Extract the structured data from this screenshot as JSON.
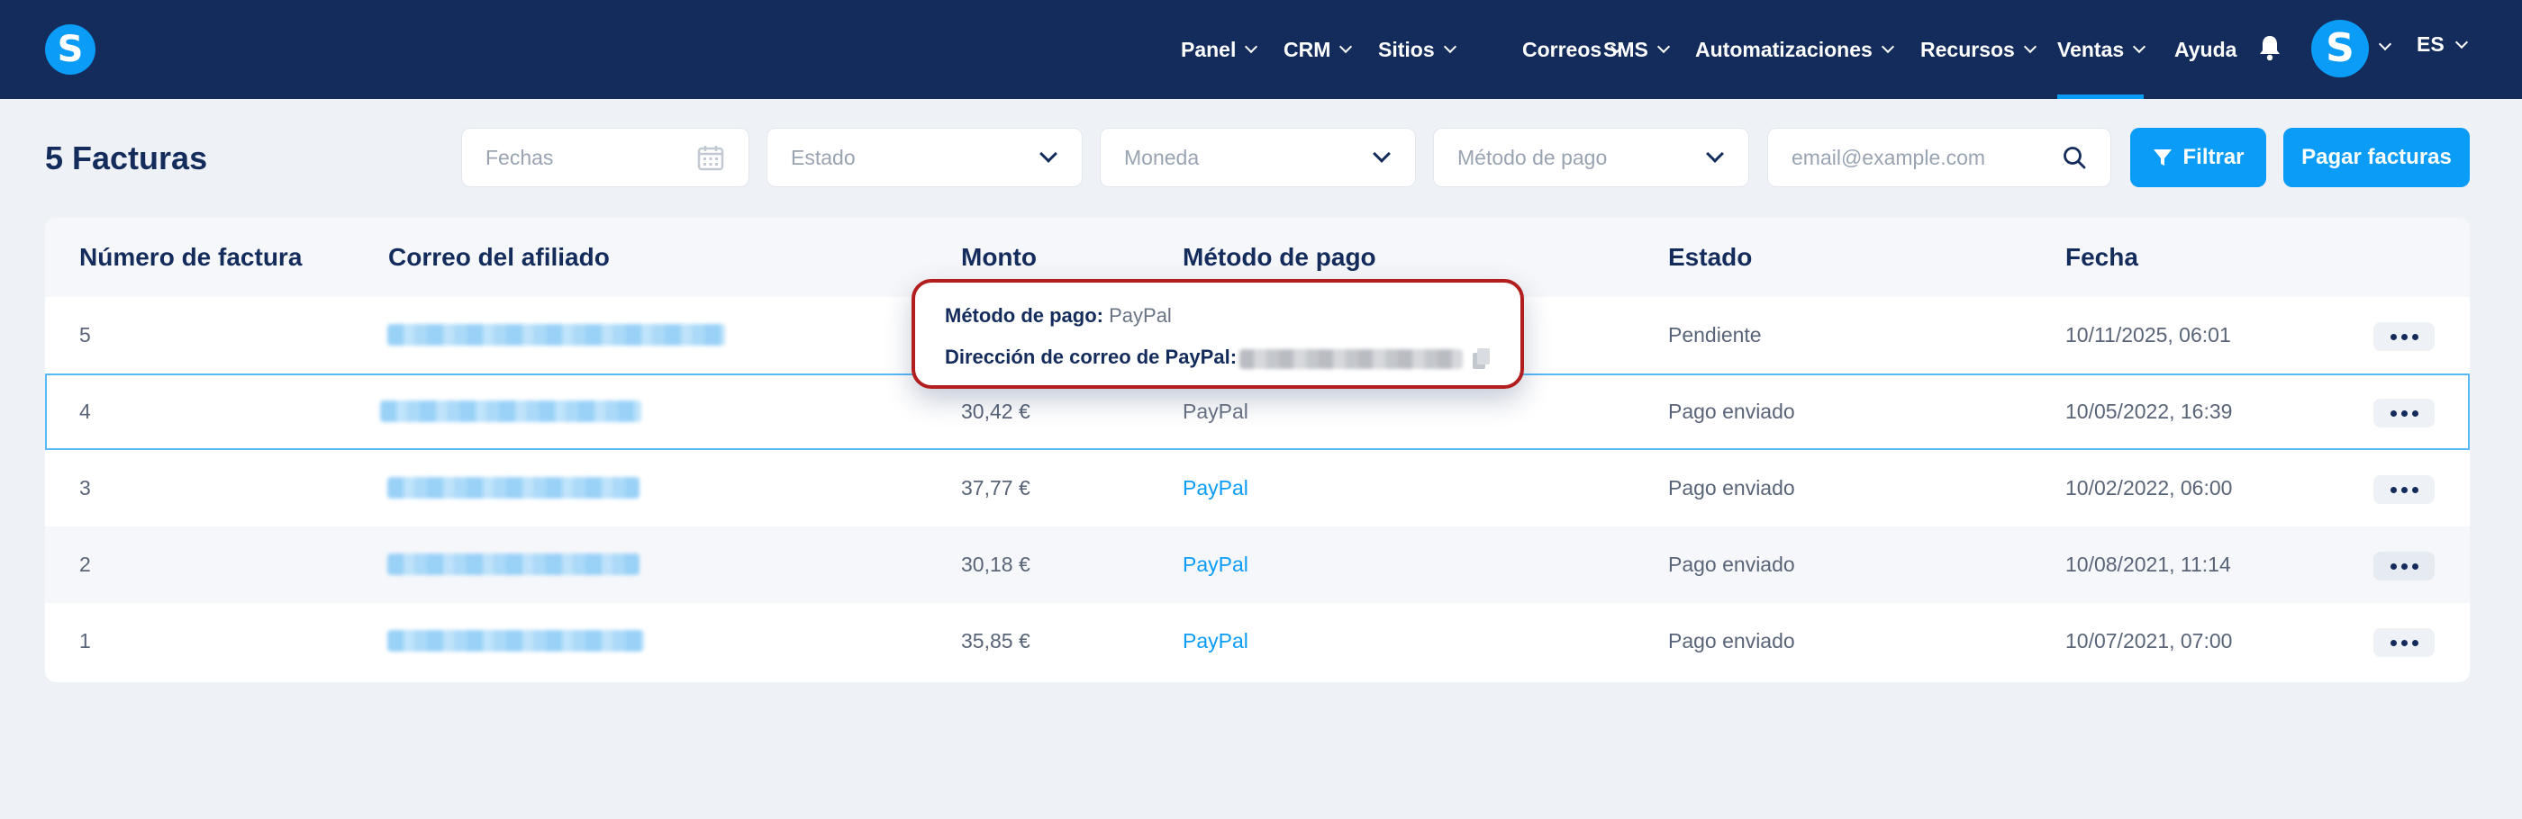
{
  "nav": {
    "items": [
      {
        "label": "Panel"
      },
      {
        "label": "CRM"
      },
      {
        "label": "Sitios"
      },
      {
        "label": "Correos"
      },
      {
        "label": "SMS"
      },
      {
        "label": "Automatizaciones"
      },
      {
        "label": "Recursos"
      },
      {
        "label": "Ventas",
        "active": true
      },
      {
        "label": "Ayuda"
      }
    ],
    "logo_letter": "S",
    "avatar_letter": "S",
    "language": "ES"
  },
  "page": {
    "title": "5 Facturas"
  },
  "filters": {
    "dates_placeholder": "Fechas",
    "status_placeholder": "Estado",
    "currency_placeholder": "Moneda",
    "payment_method_placeholder": "Método de pago",
    "email_placeholder": "email@example.com",
    "filter_button": "Filtrar",
    "pay_button": "Pagar facturas"
  },
  "table": {
    "headers": [
      "Número de factura",
      "Correo del afiliado",
      "Monto",
      "Método de pago",
      "Estado",
      "Fecha"
    ],
    "rows": [
      {
        "number": "5",
        "amount": "",
        "method": "",
        "status": "Pendiente",
        "date": "10/11/2025, 06:01"
      },
      {
        "number": "4",
        "amount": "30,42 €",
        "method": "PayPal",
        "status": "Pago enviado",
        "date": "10/05/2022, 16:39"
      },
      {
        "number": "3",
        "amount": "37,77 €",
        "method": "PayPal",
        "status": "Pago enviado",
        "date": "10/02/2022, 06:00"
      },
      {
        "number": "2",
        "amount": "30,18 €",
        "method": "PayPal",
        "status": "Pago enviado",
        "date": "10/08/2021, 11:14"
      },
      {
        "number": "1",
        "amount": "35,85 €",
        "method": "PayPal",
        "status": "Pago enviado",
        "date": "10/07/2021, 07:00"
      }
    ]
  },
  "tooltip": {
    "method_label": "Método de pago:",
    "method_value": "PayPal",
    "email_label": "Dirección de correo de PayPal:"
  },
  "colors": {
    "nav_bg": "#142c5c",
    "accent": "#0a9cf6",
    "tooltip_border": "#b21e1e"
  }
}
